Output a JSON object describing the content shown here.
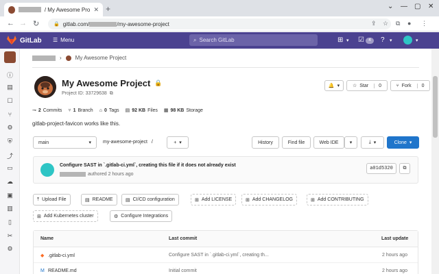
{
  "browser": {
    "tab_title": "/ My Awesome Project",
    "url_prefix": "gitlab.com/",
    "url_suffix": "/my-awesome-project"
  },
  "navbar": {
    "brand": "GitLab",
    "menu_label": "Menu",
    "search_placeholder": "Search GitLab",
    "mr_count": "4"
  },
  "breadcrumb": {
    "project": "My Awesome Project"
  },
  "project": {
    "name": "My Awesome Project",
    "id_text": "Project ID: 33729638",
    "star_label": "Star",
    "star_count": "0",
    "fork_label": "Fork",
    "fork_count": "0",
    "description": "gitlab-project-favicon works like this."
  },
  "stats": {
    "commits": "2",
    "commits_label": "Commits",
    "branches": "1",
    "branches_label": "Branch",
    "tags": "0",
    "tags_label": "Tags",
    "files_size": "92 KB",
    "files_label": "Files",
    "storage_size": "98 KB",
    "storage_label": "Storage"
  },
  "repo": {
    "branch": "main",
    "path": "my-awesome-project",
    "path_sep": "/",
    "history": "History",
    "find_file": "Find file",
    "web_ide": "Web IDE",
    "clone": "Clone"
  },
  "last_commit": {
    "message": "Configure SAST in `.gitlab-ci.yml`, creating this file if it does not already exist",
    "authored": "authored 2 hours ago",
    "sha": "a01d5320"
  },
  "quick_actions": [
    {
      "label": "Upload File"
    },
    {
      "label": "README"
    },
    {
      "label": "CI/CD configuration"
    },
    {
      "label": "Add LICENSE"
    },
    {
      "label": "Add CHANGELOG"
    },
    {
      "label": "Add CONTRIBUTING"
    },
    {
      "label": "Add Kubernetes cluster"
    },
    {
      "label": "Configure Integrations"
    }
  ],
  "files_table": {
    "headers": {
      "name": "Name",
      "last_commit": "Last commit",
      "last_update": "Last update"
    },
    "rows": [
      {
        "name": ".gitlab-ci.yml",
        "commit": "Configure SAST in `.gitlab-ci.yml`, creating th...",
        "updated": "2 hours ago"
      },
      {
        "name": "README.md",
        "commit": "Initial commit",
        "updated": "2 hours ago"
      }
    ]
  },
  "colors": {
    "navbar": "#4b4290",
    "clone_button": "#1f75cb",
    "gitlab_orange": "#fc6d26"
  }
}
